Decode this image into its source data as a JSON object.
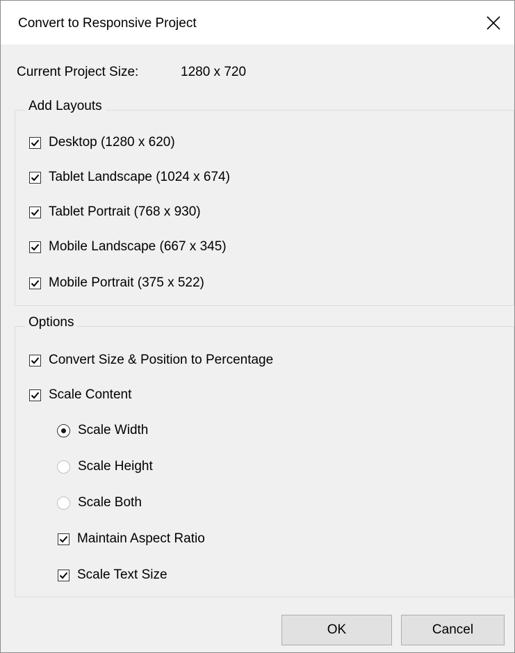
{
  "dialog": {
    "title": "Convert to Responsive Project",
    "close_icon": "close-icon"
  },
  "project_size": {
    "label": "Current Project Size:",
    "value": "1280 x 720"
  },
  "add_layouts": {
    "legend": "Add Layouts",
    "items": [
      {
        "label": "Desktop (1280 x 620)",
        "checked": true
      },
      {
        "label": "Tablet Landscape (1024 x 674)",
        "checked": true
      },
      {
        "label": "Tablet Portrait (768 x 930)",
        "checked": true
      },
      {
        "label": "Mobile Landscape (667 x 345)",
        "checked": true
      },
      {
        "label": "Mobile Portrait (375 x 522)",
        "checked": true
      }
    ]
  },
  "options": {
    "legend": "Options",
    "convert_percentage": {
      "label": "Convert Size & Position to Percentage",
      "checked": true
    },
    "scale_content": {
      "label": "Scale Content",
      "checked": true
    },
    "scale_mode": {
      "selected": "Scale Width",
      "choices": [
        {
          "label": "Scale Width",
          "selected": true
        },
        {
          "label": "Scale Height",
          "selected": false
        },
        {
          "label": "Scale Both",
          "selected": false
        }
      ]
    },
    "maintain_aspect": {
      "label": "Maintain Aspect Ratio",
      "checked": true
    },
    "scale_text": {
      "label": "Scale Text Size",
      "checked": true
    }
  },
  "buttons": {
    "ok_label": "OK",
    "cancel_label": "Cancel"
  }
}
